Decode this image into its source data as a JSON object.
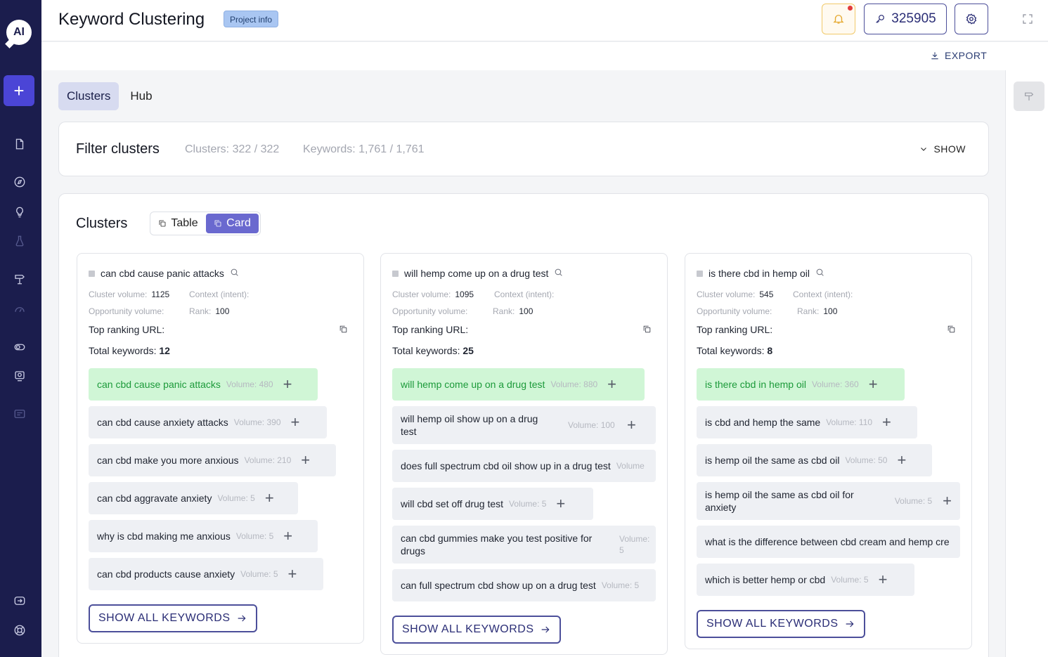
{
  "app": {
    "logo_text": "AI"
  },
  "header": {
    "title": "Keyword Clustering",
    "project_info": "Project info",
    "credits": "325905"
  },
  "export_label": "EXPORT",
  "tabs": [
    {
      "label": "Clusters",
      "active": true
    },
    {
      "label": "Hub",
      "active": false
    }
  ],
  "filter": {
    "title": "Filter clusters",
    "clusters_stat": "Clusters: 322 / 322",
    "keywords_stat": "Keywords: 1,761 / 1,761",
    "show_label": "SHOW"
  },
  "clusters": {
    "title": "Clusters",
    "view_table": "Table",
    "view_card": "Card",
    "labels": {
      "cluster_volume": "Cluster volume:",
      "context": "Context (intent):",
      "opportunity": "Opportunity volume:",
      "rank": "Rank:",
      "top_url": "Top ranking URL:",
      "total_keywords": "Total keywords:",
      "show_all": "SHOW ALL KEYWORDS"
    },
    "cards": [
      {
        "name": "can cbd cause panic attacks",
        "cluster_volume": "1125",
        "rank": "100",
        "total_keywords": "12",
        "keywords": [
          {
            "text": "can cbd cause panic attacks",
            "volume": "Volume: 480"
          },
          {
            "text": "can cbd cause anxiety attacks",
            "volume": "Volume: 390"
          },
          {
            "text": "can cbd make you more anxious",
            "volume": "Volume: 210"
          },
          {
            "text": "can cbd aggravate anxiety",
            "volume": "Volume: 5"
          },
          {
            "text": "why is cbd making me anxious",
            "volume": "Volume: 5"
          },
          {
            "text": "can cbd products cause anxiety",
            "volume": "Volume: 5"
          }
        ]
      },
      {
        "name": "will hemp come up on a drug test",
        "cluster_volume": "1095",
        "rank": "100",
        "total_keywords": "25",
        "keywords": [
          {
            "text": "will hemp come up on a drug test",
            "volume": "Volume: 880"
          },
          {
            "text": "will hemp oil show up on a drug test",
            "volume": "Volume: 100"
          },
          {
            "text": "does full spectrum cbd oil show up in a drug test",
            "volume": "Volume"
          },
          {
            "text": "will cbd set off drug test",
            "volume": "Volume: 5"
          },
          {
            "text": "can cbd gummies make you test positive for drugs",
            "volume": "Volume: 5"
          },
          {
            "text": "can full spectrum cbd show up on a drug test",
            "volume": "Volume: 5"
          }
        ]
      },
      {
        "name": "is there cbd in hemp oil",
        "cluster_volume": "545",
        "rank": "100",
        "total_keywords": "8",
        "keywords": [
          {
            "text": "is there cbd in hemp oil",
            "volume": "Volume: 360"
          },
          {
            "text": "is cbd and hemp the same",
            "volume": "Volume: 110"
          },
          {
            "text": "is hemp oil the same as cbd oil",
            "volume": "Volume: 50"
          },
          {
            "text": "is hemp oil the same as cbd oil for anxiety",
            "volume": "Volume: 5"
          },
          {
            "text": "what is the difference between cbd cream and hemp cre",
            "volume": ""
          },
          {
            "text": "which is better hemp or cbd",
            "volume": "Volume: 5"
          }
        ]
      }
    ]
  }
}
